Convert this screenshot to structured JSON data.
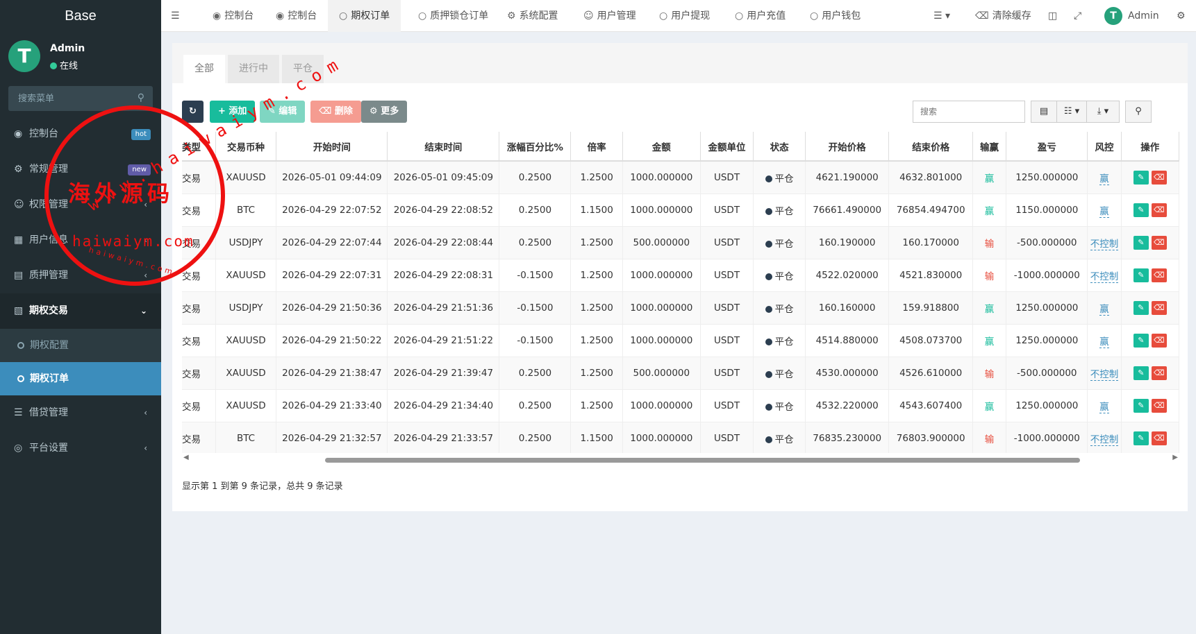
{
  "sidebar": {
    "logo": "Base",
    "user": {
      "name": "Admin",
      "status": "在线",
      "avatar": "T"
    },
    "search_placeholder": "搜索菜单",
    "items": [
      {
        "label": "控制台",
        "icon": "dashboard-icon",
        "badge": "hot"
      },
      {
        "label": "常规管理",
        "icon": "gears-icon",
        "badge": "new"
      },
      {
        "label": "权限管理",
        "icon": "users-icon"
      },
      {
        "label": "用户信息",
        "icon": "book-icon"
      },
      {
        "label": "质押管理",
        "icon": "list-icon"
      },
      {
        "label": "期权交易",
        "icon": "file-icon"
      },
      {
        "label": "借贷管理",
        "icon": "list-icon"
      },
      {
        "label": "平台设置",
        "icon": "circle-icon"
      }
    ],
    "submenu": [
      {
        "label": "期权配置"
      },
      {
        "label": "期权订单"
      }
    ]
  },
  "topbar": {
    "tabs": [
      {
        "label": "控制台"
      },
      {
        "label": "控制台"
      },
      {
        "label": "期权订单"
      },
      {
        "label": "质押锁仓订单"
      },
      {
        "label": "系统配置"
      },
      {
        "label": "用户管理"
      },
      {
        "label": "用户提现"
      },
      {
        "label": "用户充值"
      },
      {
        "label": "用户钱包"
      }
    ],
    "clear_cache": "清除缓存",
    "admin": "Admin"
  },
  "content": {
    "filter_tabs": [
      "全部",
      "进行中",
      "平仓"
    ],
    "toolbar": {
      "add": "添加",
      "edit": "编辑",
      "delete": "删除",
      "more": "更多",
      "search_placeholder": "搜索"
    },
    "table": {
      "headers": [
        "类型",
        "交易币种",
        "开始时间",
        "结束时间",
        "涨幅百分比%",
        "倍率",
        "金额",
        "金额单位",
        "状态",
        "开始价格",
        "结束价格",
        "输赢",
        "盈亏",
        "风控",
        "操作"
      ],
      "rows": [
        [
          "交易",
          "XAUUSD",
          "2026-05-01 09:44:09",
          "2026-05-01 09:45:09",
          "0.2500",
          "1.2500",
          "1000.000000",
          "USDT",
          "平仓",
          "4621.190000",
          "4632.801000",
          "赢",
          "1250.000000",
          "赢"
        ],
        [
          "交易",
          "BTC",
          "2026-04-29 22:07:52",
          "2026-04-29 22:08:52",
          "0.2500",
          "1.1500",
          "1000.000000",
          "USDT",
          "平仓",
          "76661.490000",
          "76854.494700",
          "赢",
          "1150.000000",
          "赢"
        ],
        [
          "交易",
          "USDJPY",
          "2026-04-29 22:07:44",
          "2026-04-29 22:08:44",
          "0.2500",
          "1.2500",
          "500.000000",
          "USDT",
          "平仓",
          "160.190000",
          "160.170000",
          "输",
          "-500.000000",
          "不控制"
        ],
        [
          "交易",
          "XAUUSD",
          "2026-04-29 22:07:31",
          "2026-04-29 22:08:31",
          "-0.1500",
          "1.2500",
          "1000.000000",
          "USDT",
          "平仓",
          "4522.020000",
          "4521.830000",
          "输",
          "-1000.000000",
          "不控制"
        ],
        [
          "交易",
          "USDJPY",
          "2026-04-29 21:50:36",
          "2026-04-29 21:51:36",
          "-0.1500",
          "1.2500",
          "1000.000000",
          "USDT",
          "平仓",
          "160.160000",
          "159.918800",
          "赢",
          "1250.000000",
          "赢"
        ],
        [
          "交易",
          "XAUUSD",
          "2026-04-29 21:50:22",
          "2026-04-29 21:51:22",
          "-0.1500",
          "1.2500",
          "1000.000000",
          "USDT",
          "平仓",
          "4514.880000",
          "4508.073700",
          "赢",
          "1250.000000",
          "赢"
        ],
        [
          "交易",
          "XAUUSD",
          "2026-04-29 21:38:47",
          "2026-04-29 21:39:47",
          "0.2500",
          "1.2500",
          "500.000000",
          "USDT",
          "平仓",
          "4530.000000",
          "4526.610000",
          "输",
          "-500.000000",
          "不控制"
        ],
        [
          "交易",
          "XAUUSD",
          "2026-04-29 21:33:40",
          "2026-04-29 21:34:40",
          "0.2500",
          "1.2500",
          "1000.000000",
          "USDT",
          "平仓",
          "4532.220000",
          "4543.607400",
          "赢",
          "1250.000000",
          "赢"
        ],
        [
          "交易",
          "BTC",
          "2026-04-29 21:32:57",
          "2026-04-29 21:33:57",
          "0.2500",
          "1.1500",
          "1000.000000",
          "USDT",
          "平仓",
          "76835.230000",
          "76803.900000",
          "输",
          "-1000.000000",
          "不控制"
        ]
      ]
    },
    "pager": "显示第 1 到第 9 条记录，总共 9 条记录"
  },
  "watermark": {
    "main": "海外源码",
    "url": "haiwaiym.com",
    "arc": "www.haiwaiym.com",
    "small": "haiwaiym.com"
  },
  "colors": {
    "sidebar_bg": "#222d32",
    "active_blue": "#3c8dbc",
    "win": "#18bc9c",
    "lose": "#e74c3c",
    "add": "#18bc9c",
    "edit": "#7fd6c2",
    "delete": "#f59c91",
    "more": "#7b8a8b",
    "refresh": "#2c3e50"
  }
}
